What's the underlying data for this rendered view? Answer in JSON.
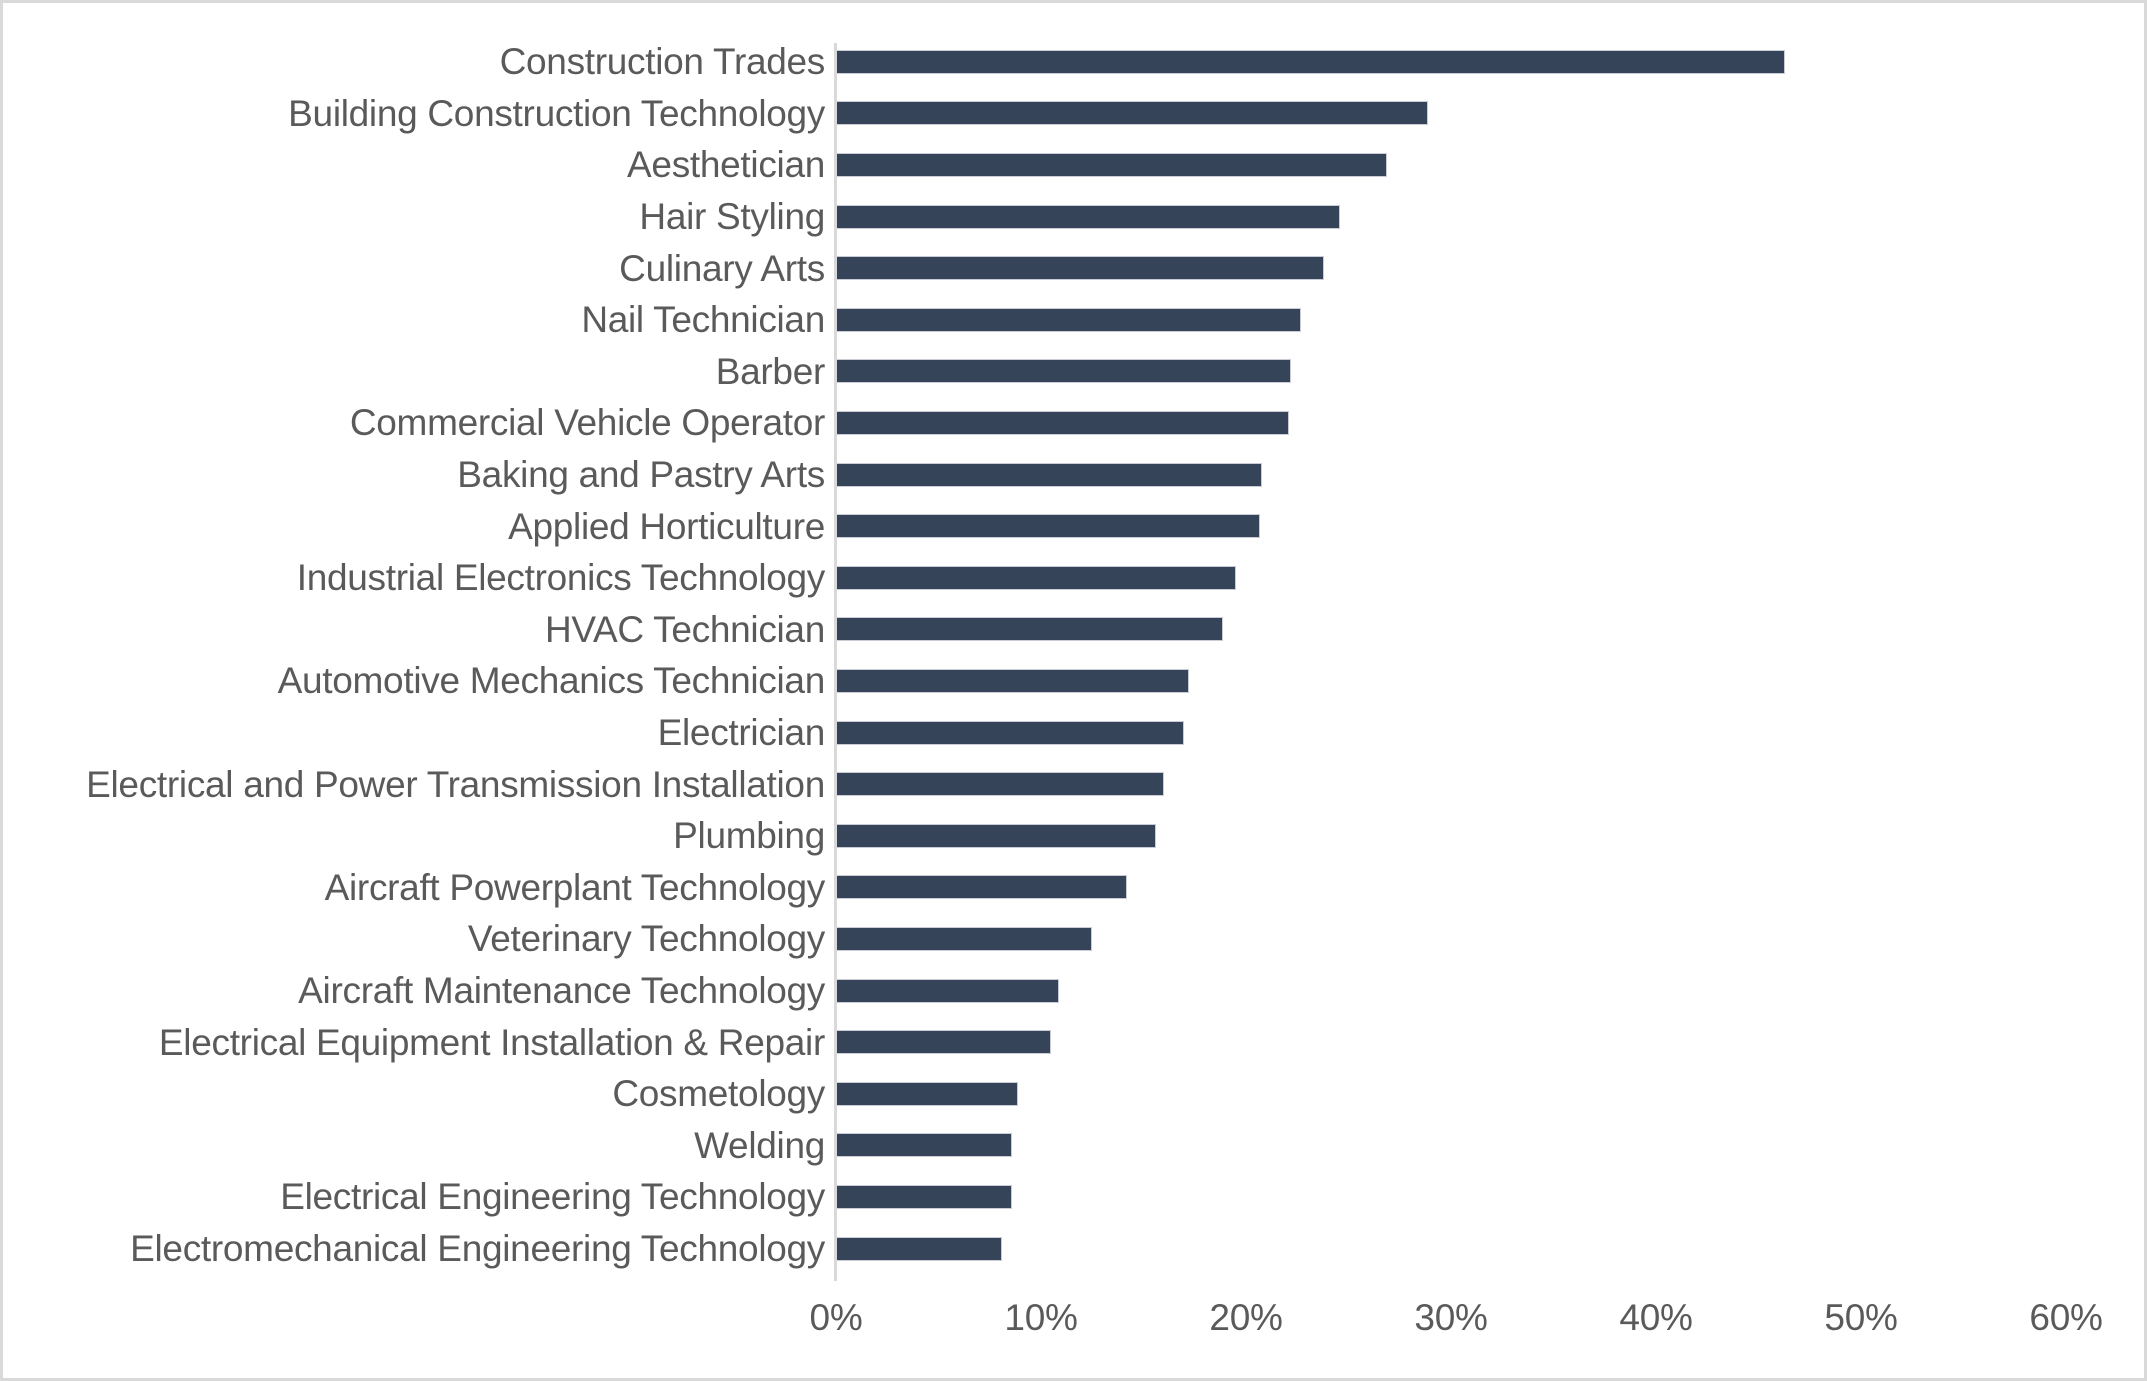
{
  "chart_data": {
    "type": "bar",
    "orientation": "horizontal",
    "title": "",
    "subtitle": "",
    "xlabel": "",
    "ylabel": "",
    "xlim": [
      0,
      60
    ],
    "x_tick_labels": [
      "0%",
      "10%",
      "20%",
      "30%",
      "40%",
      "50%",
      "60%"
    ],
    "x_tick_values": [
      0,
      10,
      20,
      30,
      40,
      50,
      60
    ],
    "grid": false,
    "legend": null,
    "value_suffix": "%",
    "bar_color": "#36445a",
    "bar_border_color": "#c9ccd4",
    "axis_line_color": "#d9d9d9",
    "label_color": "#5a5a5a",
    "frame_border_color": "#d9d9d9",
    "background": "#ffffff",
    "categories": [
      "Construction Trades",
      "Building Construction Technology",
      "Aesthetician",
      "Hair Styling",
      "Culinary Arts",
      "Nail Technician",
      "Barber",
      "Commercial Vehicle Operator",
      "Baking and Pastry Arts",
      "Applied Horticulture",
      "Industrial Electronics Technology",
      "HVAC Technician",
      "Automotive Mechanics Technician",
      "Electrician",
      "Electrical and Power Transmission Installation",
      "Plumbing",
      "Aircraft Powerplant Technology",
      "Veterinary Technology",
      "Aircraft Maintenance Technology",
      "Electrical Equipment Installation & Repair",
      "Cosmetology",
      "Welding",
      "Electrical Engineering Technology",
      "Electromechanical Engineering Technology"
    ],
    "values": [
      46.2,
      28.8,
      26.8,
      24.5,
      23.7,
      22.6,
      22.1,
      22.0,
      20.7,
      20.6,
      19.4,
      18.8,
      17.1,
      16.9,
      15.9,
      15.5,
      14.1,
      12.4,
      10.8,
      10.4,
      8.8,
      8.5,
      8.5,
      8.0
    ]
  }
}
